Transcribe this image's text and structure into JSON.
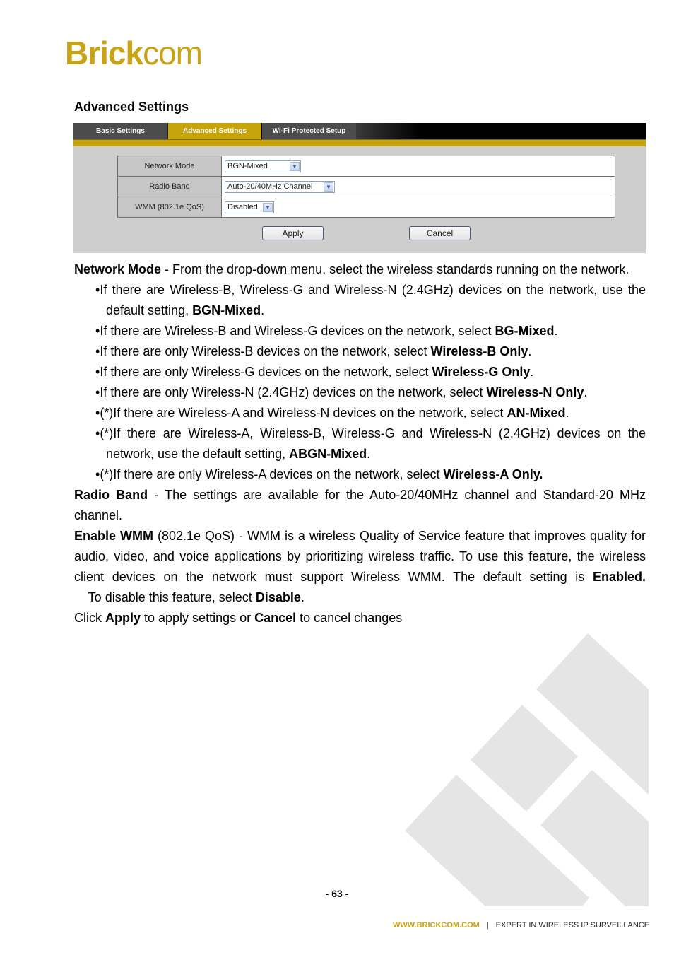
{
  "brand": {
    "logo_bold": "Brick",
    "logo_light": "com",
    "color": "#c9a316"
  },
  "section_title": "Advanced Settings",
  "ui": {
    "tabs": [
      {
        "label": "Basic Settings",
        "active": false
      },
      {
        "label": "Advanced Settings",
        "active": true
      },
      {
        "label": "Wi-Fi Protected Setup",
        "active": false
      }
    ],
    "rows": [
      {
        "label": "Network Mode",
        "value": "BGN-Mixed"
      },
      {
        "label": "Radio Band",
        "value": "Auto-20/40MHz Channel"
      },
      {
        "label": "WMM (802.1e QoS)",
        "value": "Disabled"
      }
    ],
    "apply_label": "Apply",
    "cancel_label": "Cancel",
    "accent": "#c7a40c"
  },
  "text": {
    "network_mode_term": "Network Mode",
    "network_mode_desc": " - From the drop-down menu, select the wireless standards running on the network.",
    "bullets": [
      {
        "pre": "If there are Wireless-B, Wireless-G and Wireless-N (2.4GHz) devices on the network, use the default setting, ",
        "bold": "BGN-Mixed",
        "post": "."
      },
      {
        "pre": "If there are Wireless-B and Wireless-G devices on the network, select ",
        "bold": "BG-Mixed",
        "post": "."
      },
      {
        "pre": "If there are only Wireless-B devices on the network, select ",
        "bold": "Wireless-B Only",
        "post": "."
      },
      {
        "pre": "If there are only Wireless-G devices on the network, select ",
        "bold": "Wireless-G Only",
        "post": "."
      },
      {
        "pre": "If there are only Wireless-N (2.4GHz) devices on the network, select ",
        "bold": "Wireless-N Only",
        "post": "."
      },
      {
        "pre": "(*)If there are Wireless-A and Wireless-N devices on the network, select ",
        "bold": "AN-Mixed",
        "post": "."
      },
      {
        "pre": "(*)If there are Wireless-A, Wireless-B, Wireless-G and Wireless-N (2.4GHz) devices on the network, use the default setting, ",
        "bold": "ABGN-Mixed",
        "post": "."
      },
      {
        "pre": "(*)If there are only Wireless-A devices on the network, select ",
        "bold": "Wireless-A Only.",
        "post": ""
      }
    ],
    "radio_band_term": "Radio Band",
    "radio_band_desc": " - The settings are available for the Auto-20/40MHz channel and Standard-20 MHz channel.",
    "wmm_term": "Enable WMM",
    "wmm_desc": " (802.1e QoS) - WMM is a wireless Quality of Service feature that improves quality for audio, video, and voice applications by prioritizing wireless traffic. To use this feature, the wireless client devices on the network must support Wireless WMM. The default setting is ",
    "wmm_default": "Enabled.",
    "wmm_disable_pre": "    To disable this feature, select ",
    "wmm_disable_bold": "Disable",
    "wmm_disable_post": ".",
    "click_pre": "Click ",
    "click_apply": "Apply",
    "click_mid": " to apply settings or ",
    "click_cancel": "Cancel",
    "click_post": " to cancel changes"
  },
  "page_number": "- 63 -",
  "footer": {
    "url": "WWW.BRICKCOM.COM",
    "separator": "|",
    "tagline": "EXPERT IN WIRELESS IP SURVEILLANCE"
  }
}
